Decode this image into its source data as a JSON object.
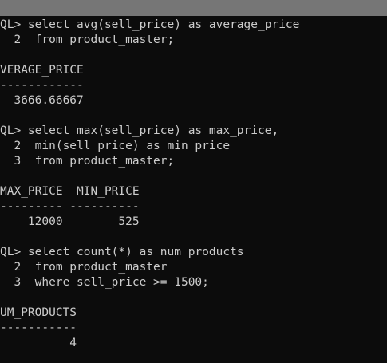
{
  "terminal": {
    "lines": [
      "QL> select avg(sell_price) as average_price",
      "  2  from product_master;",
      "",
      "VERAGE_PRICE",
      "------------",
      "  3666.66667",
      "",
      "QL> select max(sell_price) as max_price,",
      "  2  min(sell_price) as min_price",
      "  3  from product_master;",
      "",
      "MAX_PRICE  MIN_PRICE",
      "--------- ----------",
      "    12000        525",
      "",
      "QL> select count(*) as num_products",
      "  2  from product_master",
      "  3  where sell_price >= 1500;",
      "",
      "UM_PRODUCTS",
      "-----------",
      "          4"
    ]
  },
  "colors": {
    "background": "#0c0c0c",
    "text": "#cccccc",
    "top_bar": "#767676"
  }
}
